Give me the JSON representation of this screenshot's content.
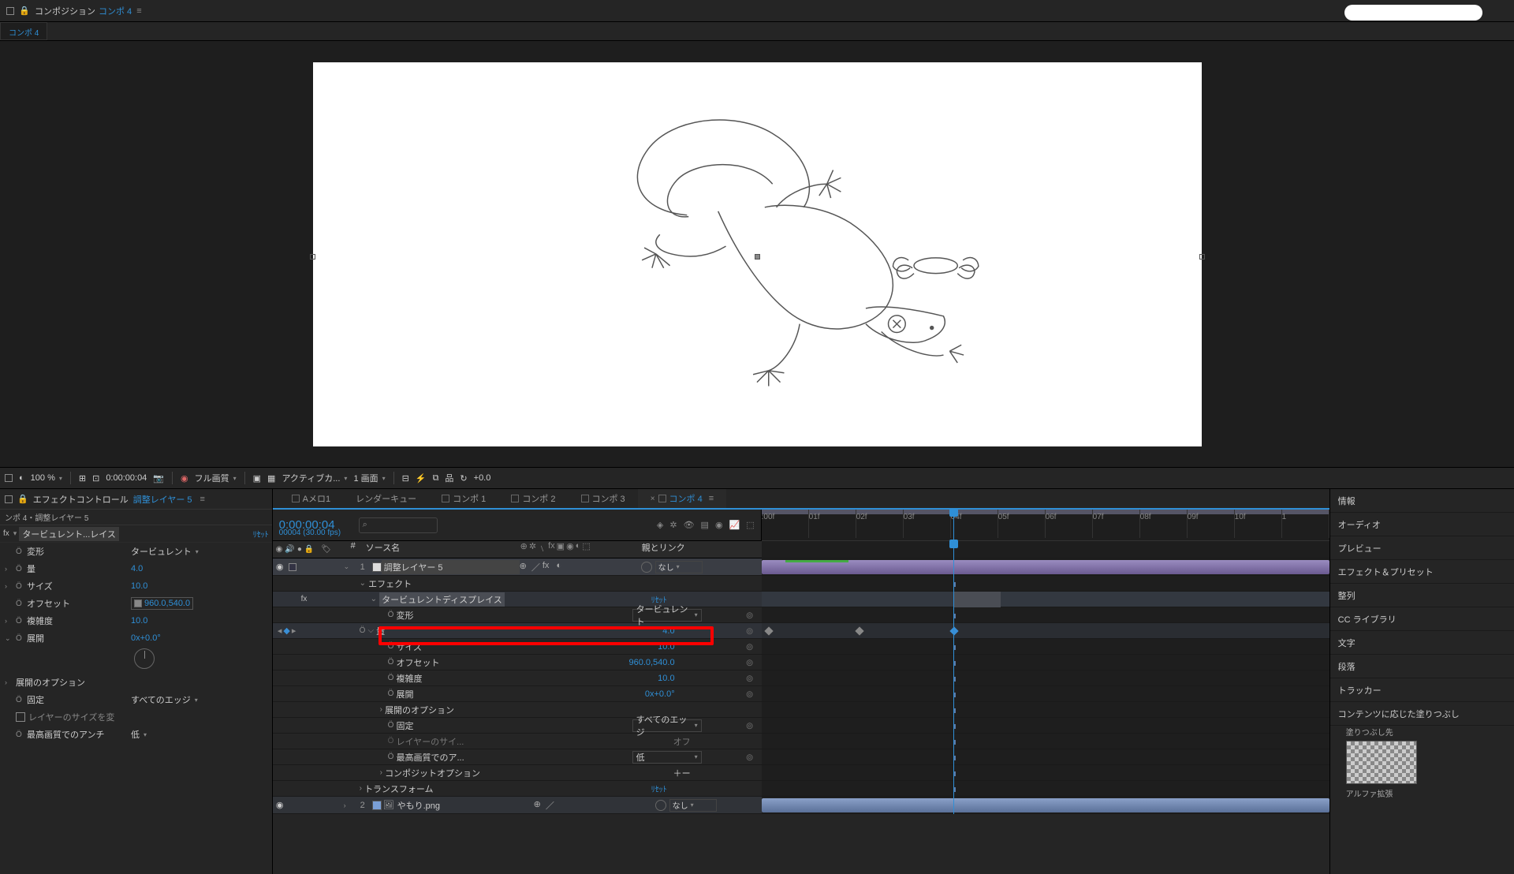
{
  "header": {
    "prefix": "コンポジション",
    "comp_name": "コンポ 4"
  },
  "tab": "コンポ 4",
  "viewer_toolbar": {
    "zoom": "100 %",
    "timecode": "0:00:00:04",
    "quality": "フル画質",
    "view_mode": "アクティブカ...",
    "views": "1 画面",
    "exposure": "+0.0"
  },
  "effect_panel": {
    "title_prefix": "エフェクトコントロール",
    "title_layer": "調整レイヤー 5",
    "breadcrumb": "ンポ 4・調整レイヤー 5",
    "effect_name": "タービュレント...レイス",
    "reset": "ﾘｾｯﾄ",
    "props": {
      "henkei": {
        "label": "変形",
        "value": "タービュレント"
      },
      "ryou": {
        "label": "量",
        "value": "4.0"
      },
      "size": {
        "label": "サイズ",
        "value": "10.0"
      },
      "offset": {
        "label": "オフセット",
        "value": "960.0,540.0"
      },
      "complex": {
        "label": "複雑度",
        "value": "10.0"
      },
      "tenkai": {
        "label": "展開",
        "value": "0x+0.0°"
      },
      "tenkai_opt": "展開のオプション",
      "kotei": {
        "label": "固定",
        "value": "すべてのエッジ"
      },
      "layer_size": "レイヤーのサイズを変",
      "best_aa": {
        "label": "最高画質でのアンチ",
        "value": "低"
      }
    }
  },
  "timeline": {
    "tabs": [
      "Aメロ1",
      "レンダーキュー",
      "コンポ 1",
      "コンポ 2",
      "コンポ 3",
      "コンポ 4"
    ],
    "active_tab": 5,
    "time": "0:00:00:04",
    "time_sub": "00004 (30.00 fps)",
    "col_num": "#",
    "col_src": "ソース名",
    "col_parent": "親とリンク",
    "parent_none": "なし",
    "ticks": [
      ":00f",
      "01f",
      "02f",
      "03f",
      "04f",
      "05f",
      "06f",
      "07f",
      "08f",
      "09f",
      "10f",
      "1"
    ],
    "layer1": {
      "num": "1",
      "name": "調整レイヤー 5"
    },
    "eff_header": "エフェクト",
    "eff_name": "タービュレントディスプレイス",
    "reset": "ﾘｾｯﾄ",
    "p_henkei": {
      "label": "変形",
      "value": "タービュレント"
    },
    "p_ryou": {
      "label": "量",
      "value": "4.0"
    },
    "p_size": {
      "label": "サイズ",
      "value": "10.0"
    },
    "p_offset": {
      "label": "オフセット",
      "value": "960.0,540.0"
    },
    "p_complex": {
      "label": "複雑度",
      "value": "10.0"
    },
    "p_tenkai": {
      "label": "展開",
      "value": "0x+0.0°"
    },
    "p_tenkai_opt": "展開のオプション",
    "p_kotei": {
      "label": "固定",
      "value": "すべてのエッジ"
    },
    "p_layer_size": {
      "label": "レイヤーのサイ...",
      "value": "オフ"
    },
    "p_best": {
      "label": "最高画質でのア...",
      "value": "低"
    },
    "p_compop": {
      "label": "コンポジットオプション",
      "value": "＋ー"
    },
    "transform": "トランスフォーム",
    "layer2": {
      "num": "2",
      "name": "やもり.png"
    }
  },
  "right": {
    "items": [
      "情報",
      "オーディオ",
      "プレビュー",
      "エフェクト＆プリセット",
      "整列",
      "CC ライブラリ",
      "文字",
      "段落",
      "トラッカー",
      "コンテンツに応じた塗りつぶし"
    ],
    "fill_label": "塗りつぶし先",
    "alpha_label": "アルファ拡張"
  }
}
